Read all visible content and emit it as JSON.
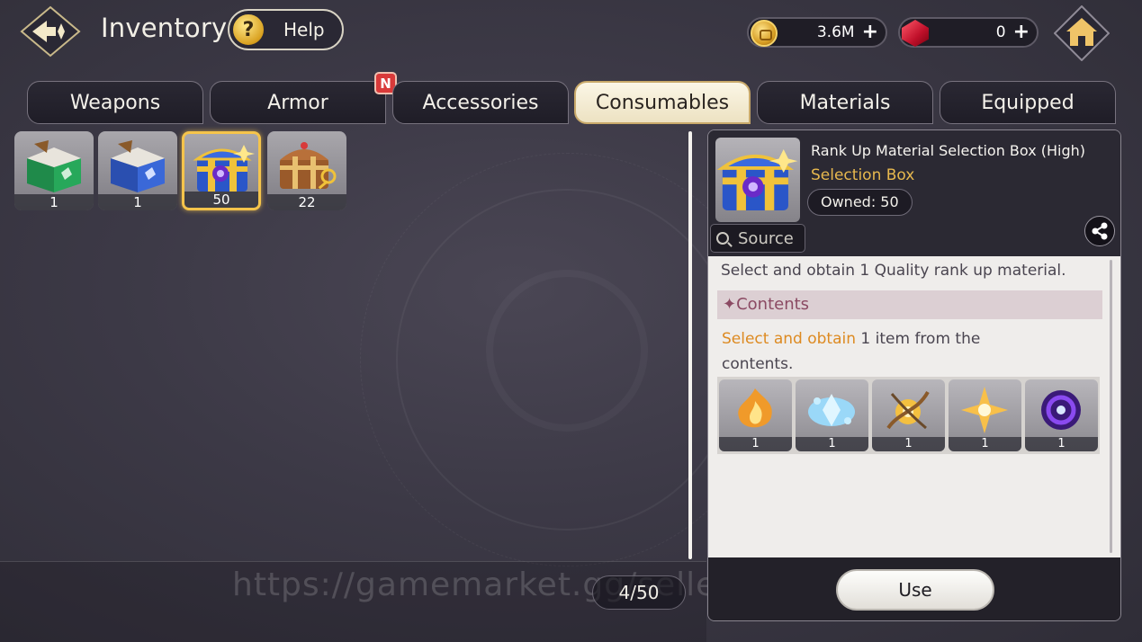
{
  "header": {
    "title": "Inventory",
    "help_label": "Help",
    "help_icon": "?",
    "gold": "3.6M",
    "gems": "0",
    "plus": "+"
  },
  "tabs": [
    {
      "label": "Weapons",
      "active": false
    },
    {
      "label": "Armor",
      "active": false,
      "badge": "N"
    },
    {
      "label": "Accessories",
      "active": false
    },
    {
      "label": "Consumables",
      "active": true
    },
    {
      "label": "Materials",
      "active": false
    },
    {
      "label": "Equipped",
      "active": false
    }
  ],
  "items": [
    {
      "icon": "green-crate-icon",
      "qty": "1"
    },
    {
      "icon": "blue-crate-icon",
      "qty": "1"
    },
    {
      "icon": "blue-gold-chest-icon",
      "qty": "50",
      "selected": true
    },
    {
      "icon": "wooden-chest-key-icon",
      "qty": "22"
    }
  ],
  "page_count": "4/50",
  "watermark": "https://gamemarket.gg/seller/GameN",
  "detail": {
    "name": "Rank Up Material Selection Box (High)",
    "type": "Selection Box",
    "owned": "Owned: 50",
    "source_label": "Source",
    "description": "Select and obtain 1 Quality rank up material.",
    "contents_label": "✦Contents",
    "select_highlight": "Select and obtain",
    "select_rest": " 1 item from the contents.",
    "rewards": [
      {
        "icon": "orange-flame-material-icon",
        "qty": "1"
      },
      {
        "icon": "ice-crystal-material-icon",
        "qty": "1"
      },
      {
        "icon": "golden-orb-material-icon",
        "qty": "1"
      },
      {
        "icon": "golden-star-burst-icon",
        "qty": "1"
      },
      {
        "icon": "purple-vortex-material-icon",
        "qty": "1"
      }
    ],
    "use_label": "Use"
  },
  "colors": {
    "accent_gold": "#e7b84e",
    "highlight_orange": "#dd8a21",
    "contents_text": "#8b4a63",
    "badge_red": "#d93a3a"
  }
}
